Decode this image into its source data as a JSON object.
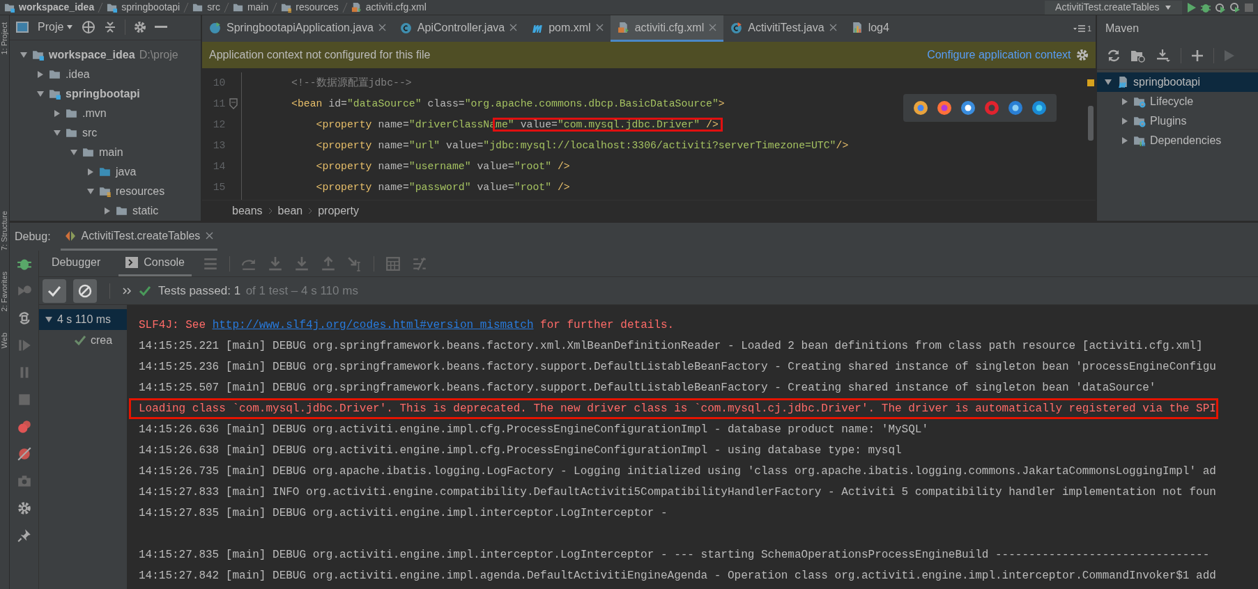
{
  "top_bar": {
    "breadcrumb": [
      {
        "label": "workspace_idea",
        "kind": "module"
      },
      {
        "label": "springbootapi",
        "kind": "module"
      },
      {
        "label": "src",
        "kind": "folder"
      },
      {
        "label": "main",
        "kind": "folder"
      },
      {
        "label": "resources",
        "kind": "resources"
      },
      {
        "label": "activiti.cfg.xml",
        "kind": "xml"
      }
    ],
    "run_config": "ActivitiTest.createTables"
  },
  "tool_strip": [
    "1: Project",
    "7: Structure",
    "2: Favorites",
    "Web"
  ],
  "project_panel": {
    "title": "Proje",
    "tree": [
      {
        "label": "workspace_idea",
        "hint": "D:\\proje",
        "kind": "module",
        "expanded": true,
        "children": [
          {
            "label": ".idea",
            "kind": "folder",
            "expanded": false
          },
          {
            "label": "springbootapi",
            "kind": "module",
            "expanded": true,
            "children": [
              {
                "label": ".mvn",
                "kind": "folder",
                "expanded": false
              },
              {
                "label": "src",
                "kind": "folder",
                "expanded": true,
                "children": [
                  {
                    "label": "main",
                    "kind": "folder",
                    "expanded": true,
                    "children": [
                      {
                        "label": "java",
                        "kind": "source",
                        "expanded": false
                      },
                      {
                        "label": "resources",
                        "kind": "resources",
                        "expanded": true,
                        "children": [
                          {
                            "label": "static",
                            "kind": "folder",
                            "expanded": false
                          }
                        ]
                      }
                    ]
                  }
                ]
              }
            ]
          }
        ]
      }
    ]
  },
  "editor": {
    "tabs": [
      {
        "label": "SpringbootapiApplication.java",
        "kind": "spring",
        "selected": false,
        "closable": true
      },
      {
        "label": "ApiController.java",
        "kind": "class",
        "selected": false,
        "closable": true
      },
      {
        "label": "pom.xml",
        "kind": "maven",
        "selected": false,
        "closable": true
      },
      {
        "label": "activiti.cfg.xml",
        "kind": "xml",
        "selected": true,
        "closable": true
      },
      {
        "label": "ActivitiTest.java",
        "kind": "test",
        "selected": false,
        "closable": true
      },
      {
        "label": "log4",
        "kind": "properties",
        "selected": false,
        "closable": false
      }
    ],
    "tab_overflow": "1",
    "banner": {
      "text": "Application context not configured for this file",
      "link": "Configure application context"
    },
    "lines": [
      {
        "number": "10",
        "text": "        <!--数据源配置jdbc-->"
      },
      {
        "number": "11",
        "text": "        <bean id=\"dataSource\" class=\"org.apache.commons.dbcp.BasicDataSource\">",
        "folded": true
      },
      {
        "number": "12",
        "text": "            <property name=\"driverClassNa",
        "boxed": "me\" value=\"com.mysql.jdbc.Driver\" />"
      },
      {
        "number": "13",
        "text": "            <property name=\"url\" value=\"jdbc:mysql://localhost:3306/activiti?serverTimezone=UTC\"/>"
      },
      {
        "number": "14",
        "text": "            <property name=\"username\" value=\"root\" />"
      },
      {
        "number": "15",
        "text": "            <property name=\"password\" value=\"root\" />"
      }
    ],
    "breadcrumb": [
      "beans",
      "bean",
      "property"
    ]
  },
  "maven": {
    "title": "Maven",
    "tree": [
      {
        "label": "springbootapi",
        "kind": "project",
        "selected": true,
        "expanded": true,
        "children": [
          {
            "label": "Lifecycle",
            "kind": "lifecycle",
            "selected": false,
            "expanded": false
          },
          {
            "label": "Plugins",
            "kind": "plugins",
            "selected": false,
            "expanded": false
          },
          {
            "label": "Dependencies",
            "kind": "dependencies",
            "selected": false,
            "expanded": false
          }
        ]
      }
    ]
  },
  "debug": {
    "label": "Debug:",
    "session": "ActivitiTest.createTables",
    "tabs": [
      {
        "label": "Debugger",
        "selected": false
      },
      {
        "label": "Console",
        "selected": true
      }
    ],
    "filters": [
      {
        "kind": "passed",
        "on": true
      },
      {
        "kind": "ignored",
        "on": true
      }
    ],
    "status": "Tests passed: 1",
    "status_detail": "of 1 test – 4 s 110 ms",
    "tests": [
      {
        "label": "4 s 110 ms",
        "selected": true,
        "expanded": true,
        "children": [
          {
            "label": "crea",
            "selected": false,
            "passed": true
          }
        ]
      }
    ],
    "console": [
      {
        "kind": "error",
        "boxed": false,
        "text": "SLF4J: See ",
        "link": "http://www.slf4j.org/codes.html#version_mismatch",
        "after": " for further details."
      },
      {
        "kind": "log",
        "boxed": false,
        "text": "14:15:25.221 [main] DEBUG org.springframework.beans.factory.xml.XmlBeanDefinitionReader - Loaded 2 bean definitions from class path resource [activiti.cfg.xml]"
      },
      {
        "kind": "log",
        "boxed": false,
        "text": "14:15:25.236 [main] DEBUG org.springframework.beans.factory.support.DefaultListableBeanFactory - Creating shared instance of singleton bean 'processEngineConfigu"
      },
      {
        "kind": "log",
        "boxed": false,
        "text": "14:15:25.507 [main] DEBUG org.springframework.beans.factory.support.DefaultListableBeanFactory - Creating shared instance of singleton bean 'dataSource'"
      },
      {
        "kind": "error",
        "boxed": true,
        "text": "Loading class `com.mysql.jdbc.Driver'. This is deprecated. The new driver class is `com.mysql.cj.jdbc.Driver'. The driver is automatically registered via the SPI"
      },
      {
        "kind": "log",
        "boxed": false,
        "text": "14:15:26.636 [main] DEBUG org.activiti.engine.impl.cfg.ProcessEngineConfigurationImpl - database product name: 'MySQL'"
      },
      {
        "kind": "log",
        "boxed": false,
        "text": "14:15:26.638 [main] DEBUG org.activiti.engine.impl.cfg.ProcessEngineConfigurationImpl - using database type: mysql"
      },
      {
        "kind": "log",
        "boxed": false,
        "text": "14:15:26.735 [main] DEBUG org.apache.ibatis.logging.LogFactory - Logging initialized using 'class org.apache.ibatis.logging.commons.JakartaCommonsLoggingImpl' ad"
      },
      {
        "kind": "log",
        "boxed": false,
        "text": "14:15:27.833 [main] INFO org.activiti.engine.compatibility.DefaultActiviti5CompatibilityHandlerFactory - Activiti 5 compatibility handler implementation not foun"
      },
      {
        "kind": "log",
        "boxed": false,
        "text": "14:15:27.835 [main] DEBUG org.activiti.engine.impl.interceptor.LogInterceptor -"
      },
      {
        "kind": "blank"
      },
      {
        "kind": "log",
        "boxed": false,
        "text": "14:15:27.835 [main] DEBUG org.activiti.engine.impl.interceptor.LogInterceptor - --- starting SchemaOperationsProcessEngineBuild --------------------------------"
      },
      {
        "kind": "log",
        "boxed": false,
        "text": "14:15:27.842 [main] DEBUG org.activiti.engine.impl.agenda.DefaultActivitiEngineAgenda - Operation class org.activiti.engine.impl.interceptor.CommandInvoker$1 add"
      }
    ]
  }
}
